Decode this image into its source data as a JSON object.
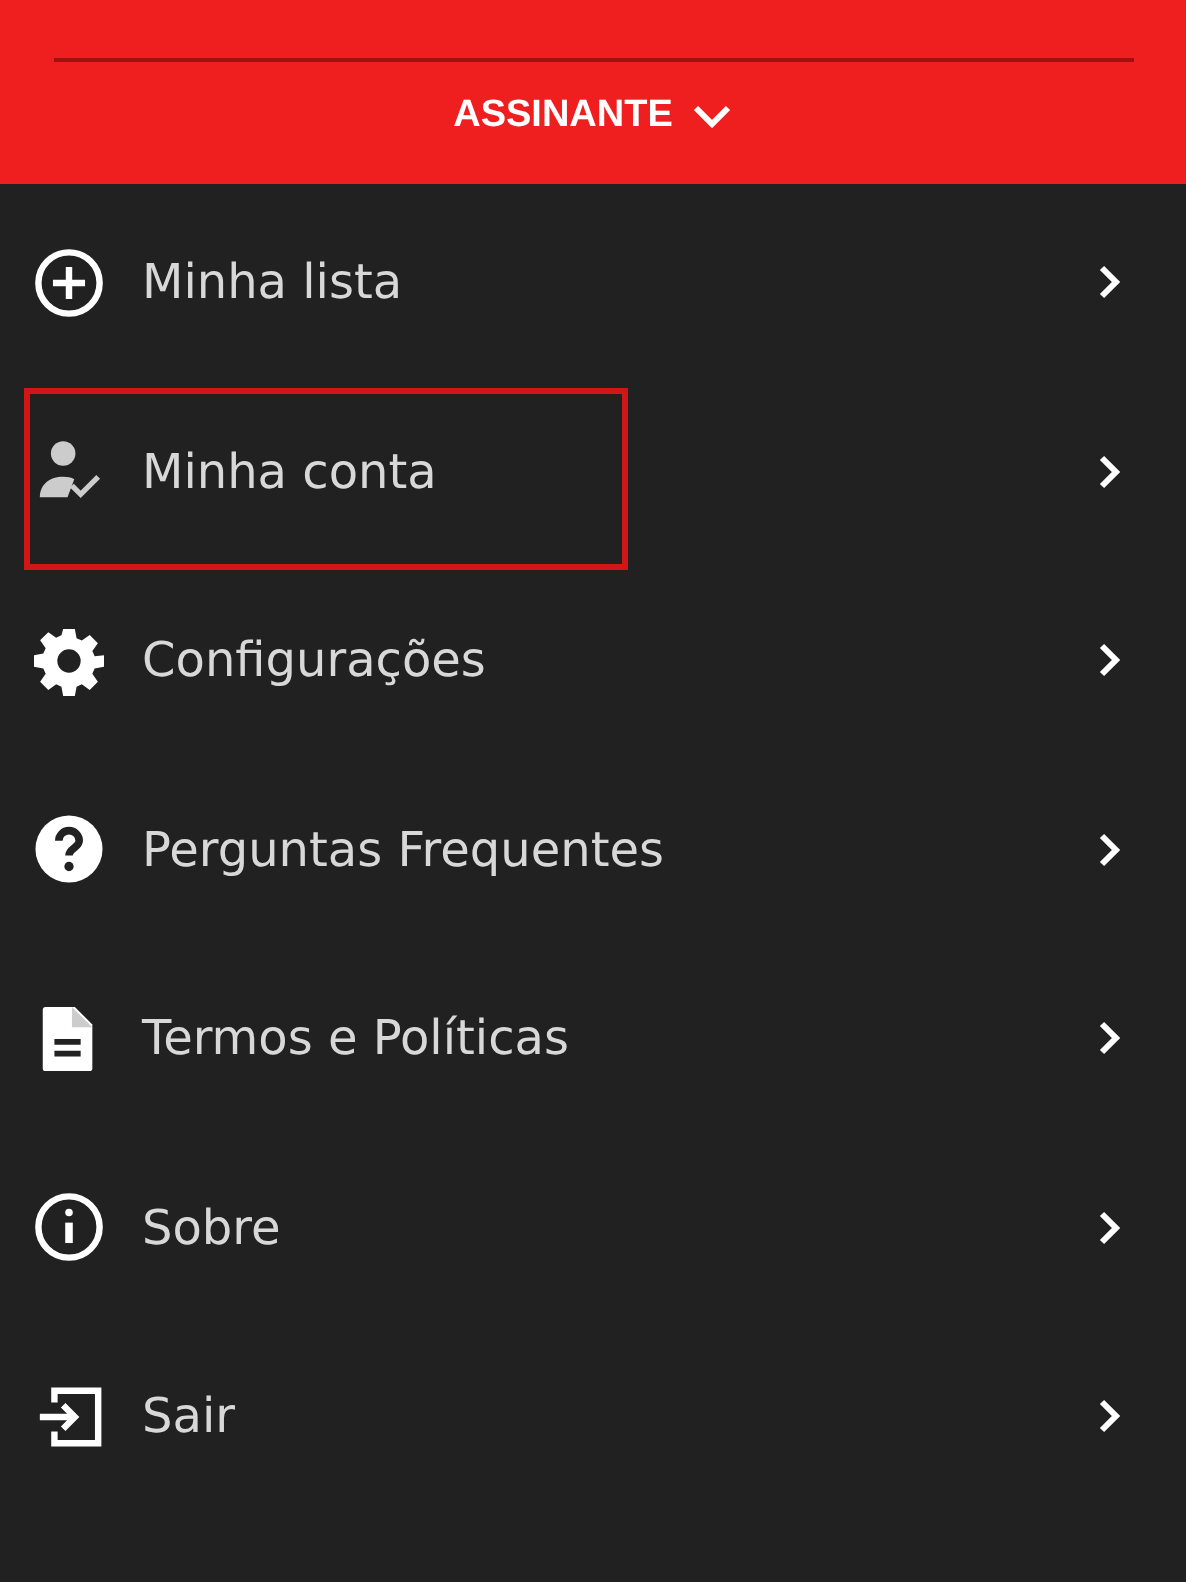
{
  "header": {
    "title": "ASSINANTE"
  },
  "menu": [
    {
      "kind": "add",
      "label": "Minha lista",
      "highlighted": false
    },
    {
      "kind": "account",
      "label": "Minha conta",
      "highlighted": true
    },
    {
      "kind": "settings",
      "label": "Configurações",
      "highlighted": false
    },
    {
      "kind": "help",
      "label": "Perguntas Frequentes",
      "highlighted": false
    },
    {
      "kind": "document",
      "label": "Termos e Políticas",
      "highlighted": false
    },
    {
      "kind": "info",
      "label": "Sobre",
      "highlighted": false
    },
    {
      "kind": "exit",
      "label": "Sair",
      "highlighted": false
    }
  ]
}
